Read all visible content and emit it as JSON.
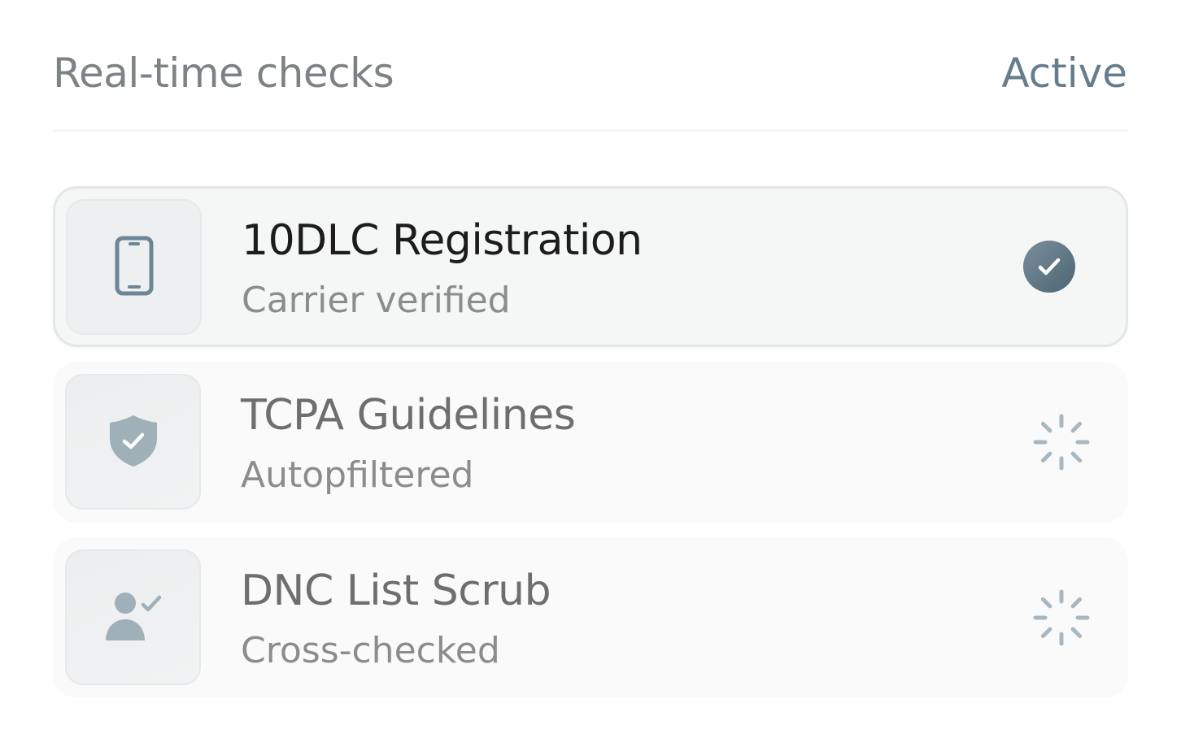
{
  "header": {
    "title": "Real-time checks",
    "status": "Active"
  },
  "checks": [
    {
      "title": "10DLC Registration",
      "subtitle": "Carrier verified",
      "icon": "smartphone-icon",
      "state": "complete"
    },
    {
      "title": "TCPA Guidelines",
      "subtitle": "Autopfiltered",
      "icon": "shield-check-icon",
      "state": "loading"
    },
    {
      "title": "DNC List Scrub",
      "subtitle": "Cross-checked",
      "icon": "user-check-icon",
      "state": "loading"
    }
  ],
  "colors": {
    "accent": "#5f7686",
    "icon": "#6b8797",
    "icon_muted": "#9fb0b9",
    "spinner": "#a9b8c0"
  }
}
